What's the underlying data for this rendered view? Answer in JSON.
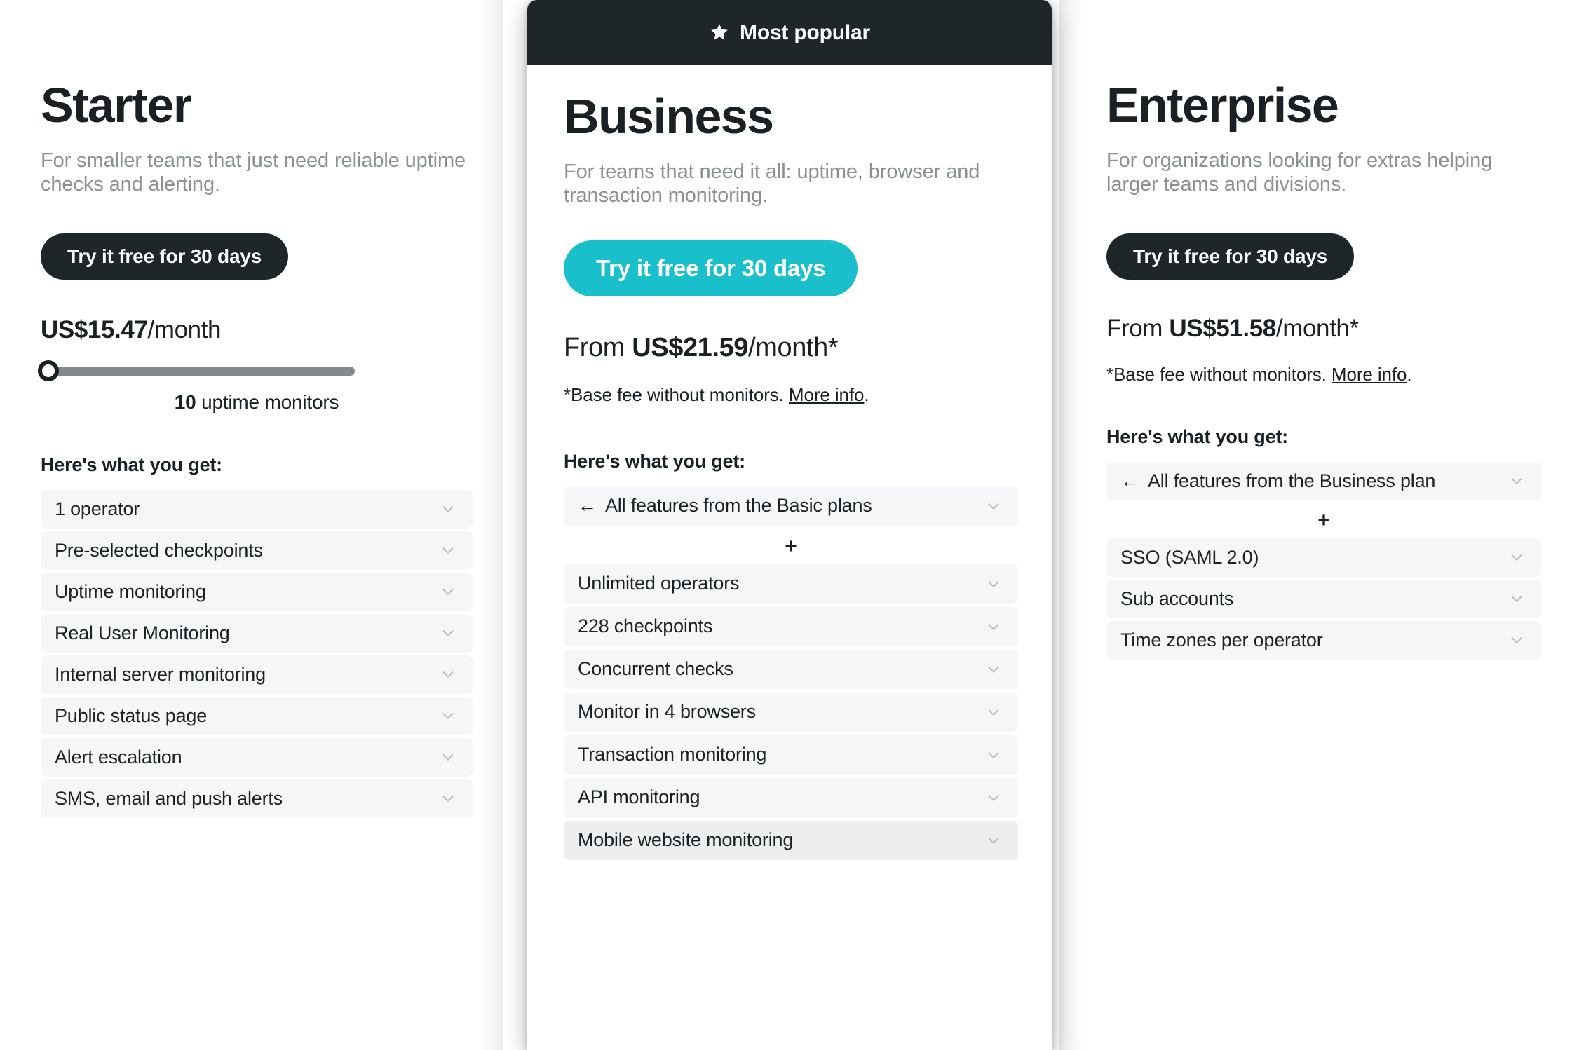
{
  "colors": {
    "accent_teal": "#19bfcb",
    "dark": "#1f2629",
    "row_bg": "#f5f6f7",
    "muted_text": "#8b9093"
  },
  "plans": [
    {
      "id": "starter",
      "title": "Starter",
      "description": "For smaller teams that just need reliable uptime checks and alerting.",
      "cta_label": "Try it free for 30 days",
      "price": {
        "prefix": "",
        "amount": "US$15.47",
        "period": "/month"
      },
      "slider": {
        "value": "10",
        "unit": "uptime monitors",
        "position_percent": 0
      },
      "features_heading": "Here's what you get:",
      "features": [
        {
          "label": "1 operator"
        },
        {
          "label": "Pre-selected checkpoints"
        },
        {
          "label": "Uptime monitoring"
        },
        {
          "label": "Real User Monitoring"
        },
        {
          "label": "Internal server monitoring"
        },
        {
          "label": "Public status page"
        },
        {
          "label": "Alert escalation"
        },
        {
          "label": "SMS, email and push alerts"
        }
      ]
    },
    {
      "id": "business",
      "badge": {
        "label": "Most popular",
        "icon": "star-icon"
      },
      "title": "Business",
      "description": "For teams that need it all: uptime, browser and transaction monitoring.",
      "cta_label": "Try it free for 30 days",
      "price": {
        "prefix": "From ",
        "amount": "US$21.59",
        "period": "/month*"
      },
      "note": {
        "text": "*Base fee without monitors. ",
        "link": "More info",
        "suffix": "."
      },
      "features_heading": "Here's what you get:",
      "inherit_row": {
        "label": "All features from the Basic plans",
        "arrow": "←"
      },
      "separator": "+",
      "features": [
        {
          "label": "Unlimited operators"
        },
        {
          "label": "228 checkpoints"
        },
        {
          "label": "Concurrent checks"
        },
        {
          "label": "Monitor in 4 browsers"
        },
        {
          "label": "Transaction monitoring"
        },
        {
          "label": "API monitoring"
        },
        {
          "label": "Mobile website monitoring",
          "hovered": true
        }
      ]
    },
    {
      "id": "enterprise",
      "title": "Enterprise",
      "description": "For organizations looking for extras helping larger teams and divisions.",
      "cta_label": "Try it free for 30 days",
      "price": {
        "prefix": "From ",
        "amount": "US$51.58",
        "period": "/month*"
      },
      "note": {
        "text": "*Base fee without monitors. ",
        "link": "More info",
        "suffix": "."
      },
      "features_heading": "Here's what you get:",
      "inherit_row": {
        "label": "All features from the Business plan",
        "arrow": "←"
      },
      "separator": "+",
      "features": [
        {
          "label": "SSO (SAML 2.0)"
        },
        {
          "label": "Sub accounts"
        },
        {
          "label": "Time zones per operator"
        }
      ]
    }
  ]
}
